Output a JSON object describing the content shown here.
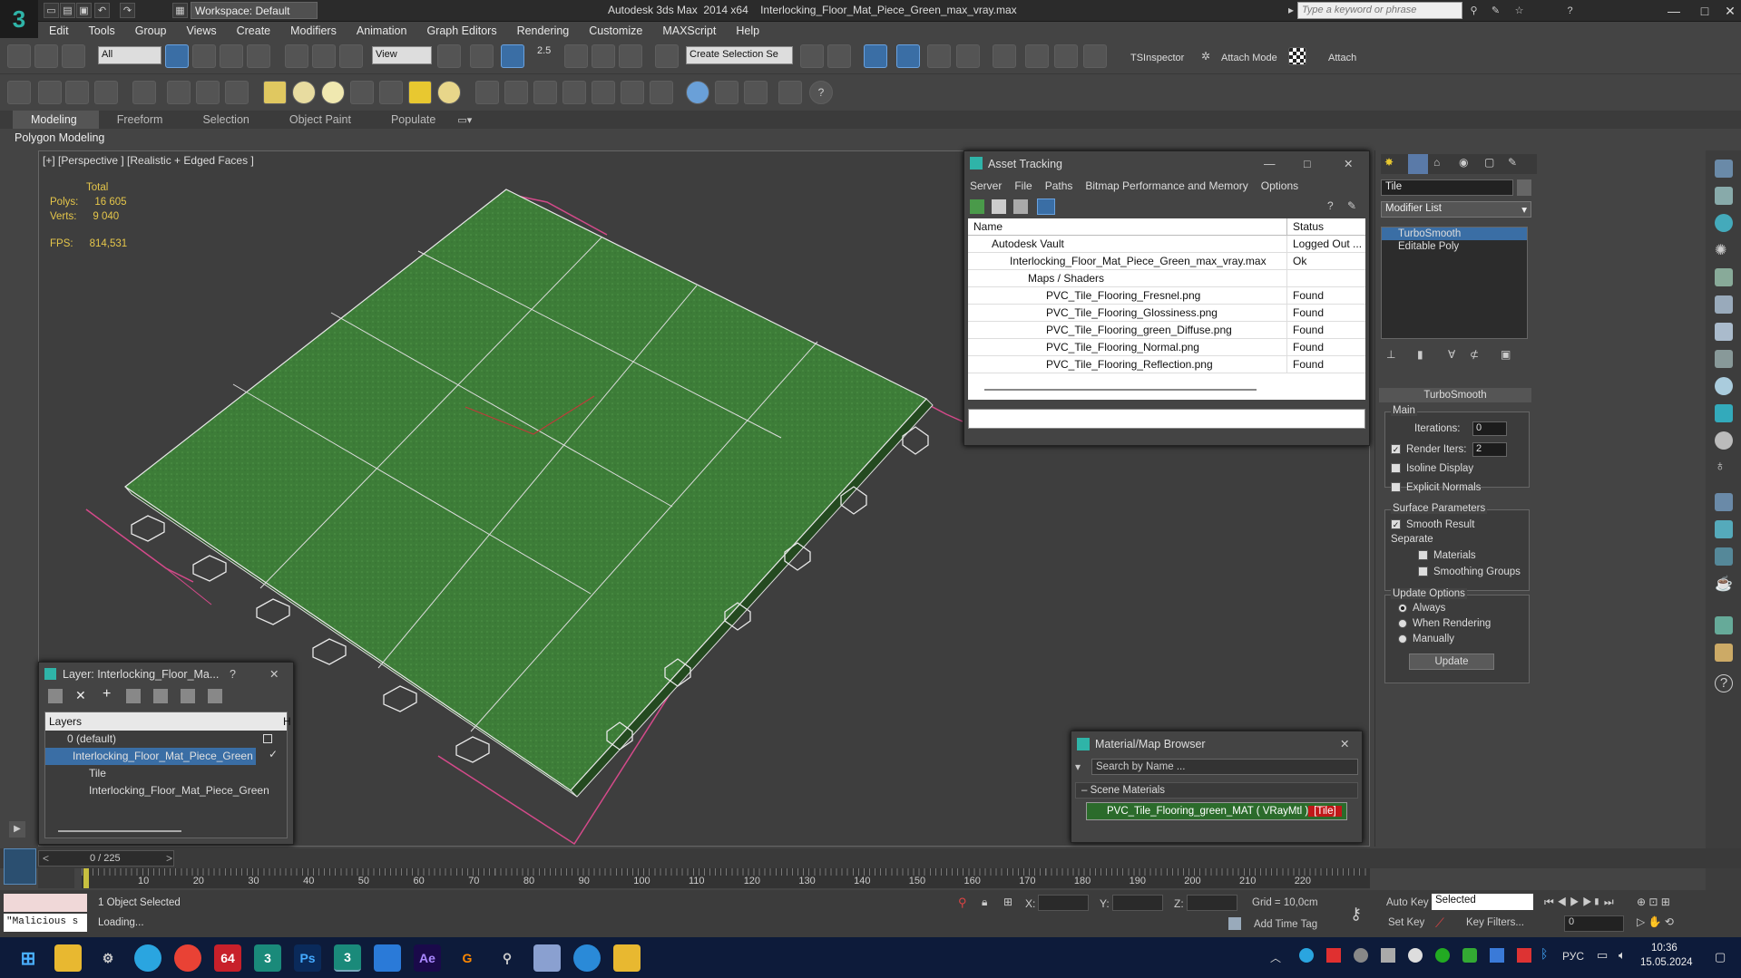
{
  "titlebar": {
    "workspace": "Workspace: Default",
    "title": "Autodesk 3ds Max  2014 x64    Interlocking_Floor_Mat_Piece_Green_max_vray.max",
    "search_placeholder": "Type a keyword or phrase",
    "win_min": "—",
    "win_max": "□",
    "win_close": "✕"
  },
  "menu": [
    "Edit",
    "Tools",
    "Group",
    "Views",
    "Create",
    "Modifiers",
    "Animation",
    "Graph Editors",
    "Rendering",
    "Customize",
    "MAXScript",
    "Help"
  ],
  "toolbar": {
    "selection_filter": "All",
    "ref_coord": "View",
    "snap_value": "2.5",
    "named_sel": "Create Selection Se",
    "ts_inspector": "TSInspector",
    "attach_mode": "Attach Mode",
    "attach": "Attach"
  },
  "ribbon": {
    "tabs": [
      "Modeling",
      "Freeform",
      "Selection",
      "Object Paint",
      "Populate"
    ],
    "sub": "Polygon Modeling"
  },
  "viewport": {
    "label": "[+] [Perspective ] [Realistic + Edged Faces ]",
    "stats": {
      "header": "Total",
      "polys_label": "Polys:",
      "polys": "16 605",
      "verts_label": "Verts:",
      "verts": "9 040",
      "fps_label": "FPS:",
      "fps": "814,531"
    },
    "floor_color": "#3f7f3a"
  },
  "asset_tracking": {
    "title": "Asset Tracking",
    "menu": [
      "Server",
      "File",
      "Paths",
      "Bitmap Performance and Memory",
      "Options"
    ],
    "col_name": "Name",
    "col_status": "Status",
    "rows": [
      {
        "name": "Autodesk Vault",
        "status": "Logged Out ..."
      },
      {
        "name": "Interlocking_Floor_Mat_Piece_Green_max_vray.max",
        "status": "Ok"
      },
      {
        "name": "Maps / Shaders",
        "status": ""
      },
      {
        "name": "PVC_Tile_Flooring_Fresnel.png",
        "status": "Found"
      },
      {
        "name": "PVC_Tile_Flooring_Glossiness.png",
        "status": "Found"
      },
      {
        "name": "PVC_Tile_Flooring_green_Diffuse.png",
        "status": "Found"
      },
      {
        "name": "PVC_Tile_Flooring_Normal.png",
        "status": "Found"
      },
      {
        "name": "PVC_Tile_Flooring_Reflection.png",
        "status": "Found"
      }
    ]
  },
  "layer_dialog": {
    "title": "Layer: Interlocking_Floor_Ma...",
    "help": "?",
    "col_layers": "Layers",
    "col_h": "H",
    "rows": [
      "0 (default)",
      "Interlocking_Floor_Mat_Piece_Green",
      "Tile",
      "Interlocking_Floor_Mat_Piece_Green"
    ]
  },
  "material_browser": {
    "title": "Material/Map Browser",
    "search_placeholder": "Search by Name ...",
    "section": "Scene Materials",
    "material_name": "PVC_Tile_Flooring_green_MAT  ( VRayMtl )  ",
    "material_tag": "[Tile]"
  },
  "modify_panel": {
    "object_name": "Tile",
    "modifier_list": "Modifier List",
    "stack": [
      "TurboSmooth",
      "Editable Poly"
    ],
    "rollout": "TurboSmooth",
    "main": "Main",
    "iterations_label": "Iterations:",
    "iterations": "0",
    "render_iters_label": "Render Iters:",
    "render_iters": "2",
    "isoline": "Isoline Display",
    "explicit": "Explicit Normals",
    "surface": "Surface Parameters",
    "smooth_result": "Smooth Result",
    "separate": "Separate",
    "materials": "Materials",
    "smoothing_groups": "Smoothing Groups",
    "update_options": "Update Options",
    "always": "Always",
    "when_rendering": "When Rendering",
    "manually": "Manually",
    "update": "Update"
  },
  "timeline": {
    "frame": "0 / 225",
    "ticks": [
      "10",
      "20",
      "30",
      "40",
      "50",
      "60",
      "70",
      "80",
      "90",
      "100",
      "110",
      "120",
      "130",
      "140",
      "150",
      "160",
      "170",
      "180",
      "190",
      "200",
      "210",
      "220"
    ]
  },
  "status": {
    "selected": "1 Object Selected",
    "loading": "Loading...",
    "script": "\"Malicious s",
    "x_label": "X:",
    "y_label": "Y:",
    "z_label": "Z:",
    "grid": "Grid = 10,0cm",
    "add_time_tag": "Add Time Tag",
    "auto_key": "Auto Key",
    "set_key": "Set Key",
    "key_mode": "Selected",
    "key_filters": "Key Filters...",
    "frame_value": "0"
  },
  "taskbar": {
    "lang": "РУС",
    "time": "10:36",
    "date": "15.05.2024",
    "apps": [
      "64",
      "Ps",
      "Ae",
      "G"
    ]
  }
}
